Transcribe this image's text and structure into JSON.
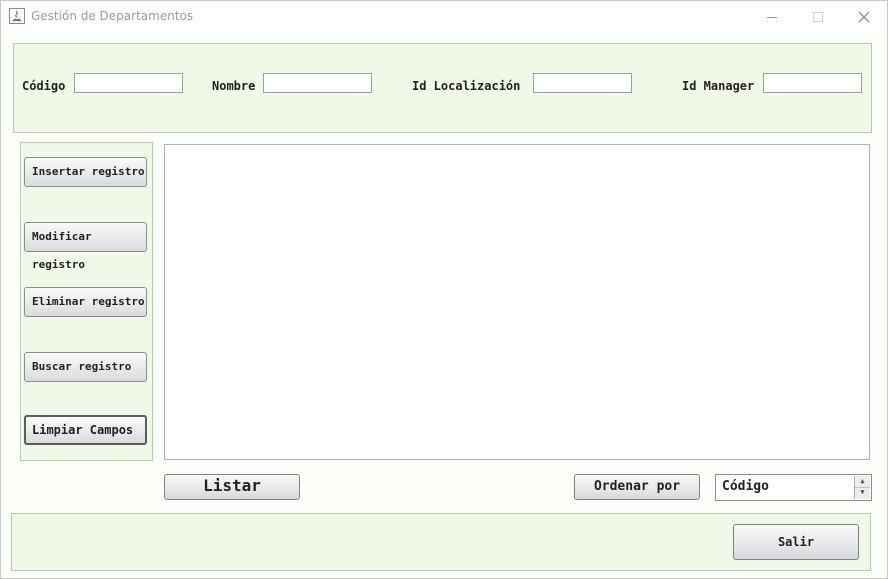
{
  "window": {
    "title": "Gestión de Departamentos",
    "controls": {
      "minimize_icon": "minimize-icon",
      "maximize_icon": "maximize-icon",
      "close_icon": "close-icon"
    }
  },
  "fields": {
    "codigo_label": "Código",
    "nombre_label": "Nombre",
    "id_localizacion_label": "Id Localización",
    "id_manager_label": "Id Manager",
    "codigo_value": "",
    "nombre_value": "",
    "id_localizacion_value": "",
    "id_manager_value": ""
  },
  "actions": {
    "insertar": "Insertar registro",
    "modificar": "Modificar registro",
    "eliminar": "Eliminar registro",
    "buscar": "Buscar registro",
    "limpiar": "Limpiar Campos"
  },
  "list": {
    "items": []
  },
  "bottom_bar": {
    "listar": "Listar",
    "ordenar_por": "Ordenar por",
    "sort_selected": "Código",
    "salir": "Salir"
  },
  "colors": {
    "panel_bg": "#f0f8e8",
    "window_bg": "#fbfdf8",
    "panel_border": "#b7c8b0"
  }
}
